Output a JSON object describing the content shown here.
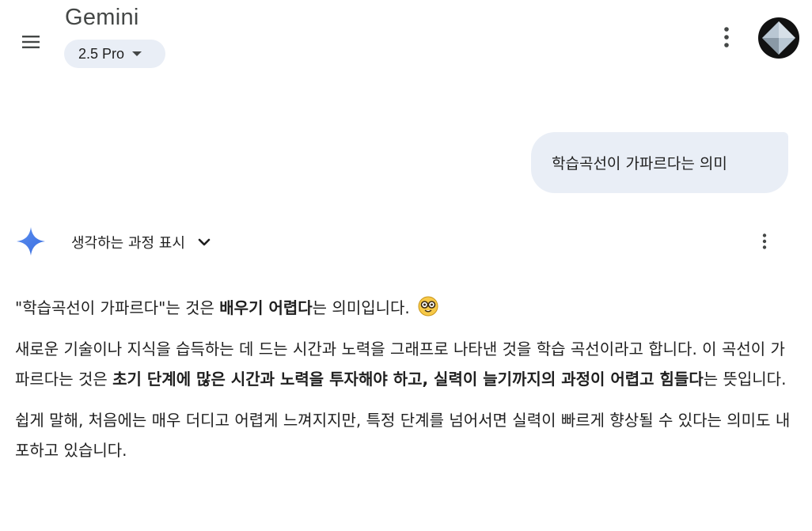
{
  "header": {
    "title": "Gemini",
    "model_label": "2.5 Pro",
    "avatar_color": "#111111"
  },
  "user_message": {
    "text": "학습곡선이 가파르다는 의미"
  },
  "response": {
    "thinking_label": "생각하는 과정 표시",
    "p1": {
      "a": "\"학습곡선이 가파르다\"는 것은 ",
      "b": "배우기 어렵다",
      "c": "는 의미입니다."
    },
    "p2": {
      "a": "새로운 기술이나 지식을 습득하는 데 드는 시간과 노력을 그래프로 나타낸 것을 학습 곡선이라고 합니다. 이 곡선이 가파르다는 것은 ",
      "b": "초기 단계에 많은 시간과 노력을 투자해야 하고, 실력이 늘기까지의 과정이 어렵고 힘들다",
      "c": "는 뜻입니다."
    },
    "p3": "쉽게 말해, 처음에는 매우 더디고 어렵게 느껴지지만, 특정 단계를 넘어서면 실력이 빠르게 향상될 수 있다는 의미도 내포하고 있습니다."
  },
  "colors": {
    "bubble_bg": "#e9eef6",
    "icon_gray": "#444746",
    "spark_blue": "#4a7ff0"
  },
  "icons": [
    "menu-icon",
    "chevron-down-icon",
    "more-vert-icon",
    "gemini-spark-icon",
    "nerd-face-emoji"
  ]
}
